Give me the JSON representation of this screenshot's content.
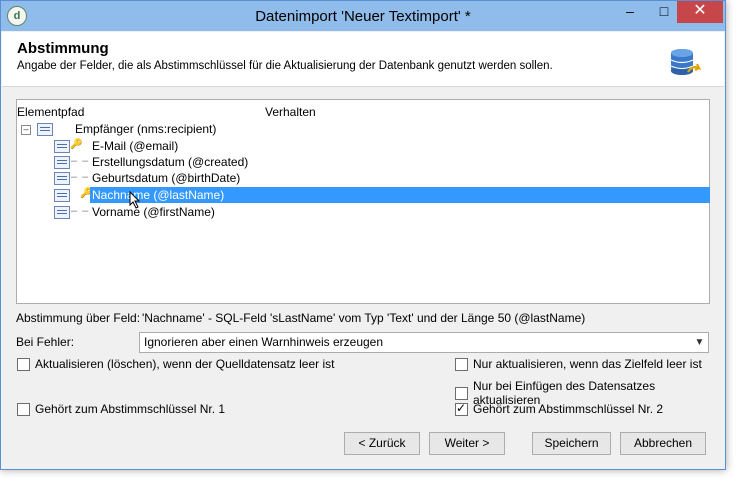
{
  "window": {
    "title": "Datenimport 'Neuer Textimport' *",
    "app_icon": "d",
    "controls": {
      "minimize": "–",
      "maximize": "□",
      "close": "✕"
    }
  },
  "header": {
    "title": "Abstimmung",
    "subtitle": "Angabe der Felder, die als Abstimmschlüssel für die Aktualisierung der Datenbank genutzt werden sollen."
  },
  "tree": {
    "columns": [
      "Elementpfad",
      "Verhalten"
    ],
    "root": {
      "label": "Empfänger (nms:recipient)",
      "expander": "–"
    },
    "items": [
      {
        "label": "E-Mail (@email)",
        "has_key": true,
        "selected": false
      },
      {
        "label": "Erstellungsdatum (@created)",
        "has_key": false,
        "selected": false
      },
      {
        "label": "Geburtsdatum (@birthDate)",
        "has_key": false,
        "selected": false
      },
      {
        "label": "Nachname (@lastName)",
        "has_key": true,
        "selected": true
      },
      {
        "label": "Vorname (@firstName)",
        "has_key": false,
        "selected": false
      }
    ]
  },
  "field_info": {
    "label": "Abstimmung über Feld:",
    "value": "'Nachname' - SQL-Feld 'sLastName' vom Typ 'Text' und der Länge 50 (@lastName)"
  },
  "on_error": {
    "label": "Bei Fehler:",
    "selected": "Ignorieren aber einen Warnhinweis erzeugen"
  },
  "options": {
    "update_delete": {
      "label": "Aktualisieren (löschen), wenn der Quelldatensatz leer ist",
      "checked": false
    },
    "only_if_empty": {
      "label": "Nur aktualisieren, wenn das Zielfeld leer ist",
      "checked": false
    },
    "only_on_insert": {
      "label": "Nur bei Einfügen des Datensatzes aktualisieren",
      "checked": false
    },
    "key1": {
      "label": "Gehört zum Abstimmschlüssel Nr. 1",
      "checked": false
    },
    "key2": {
      "label": "Gehört zum Abstimmschlüssel Nr. 2",
      "checked": true
    }
  },
  "buttons": {
    "back": "< Zurück",
    "next": "Weiter >",
    "save": "Speichern",
    "cancel": "Abbrechen"
  },
  "colors": {
    "selection": "#3399ff",
    "titlebar": "#8fbcea",
    "close": "#c7464a"
  }
}
